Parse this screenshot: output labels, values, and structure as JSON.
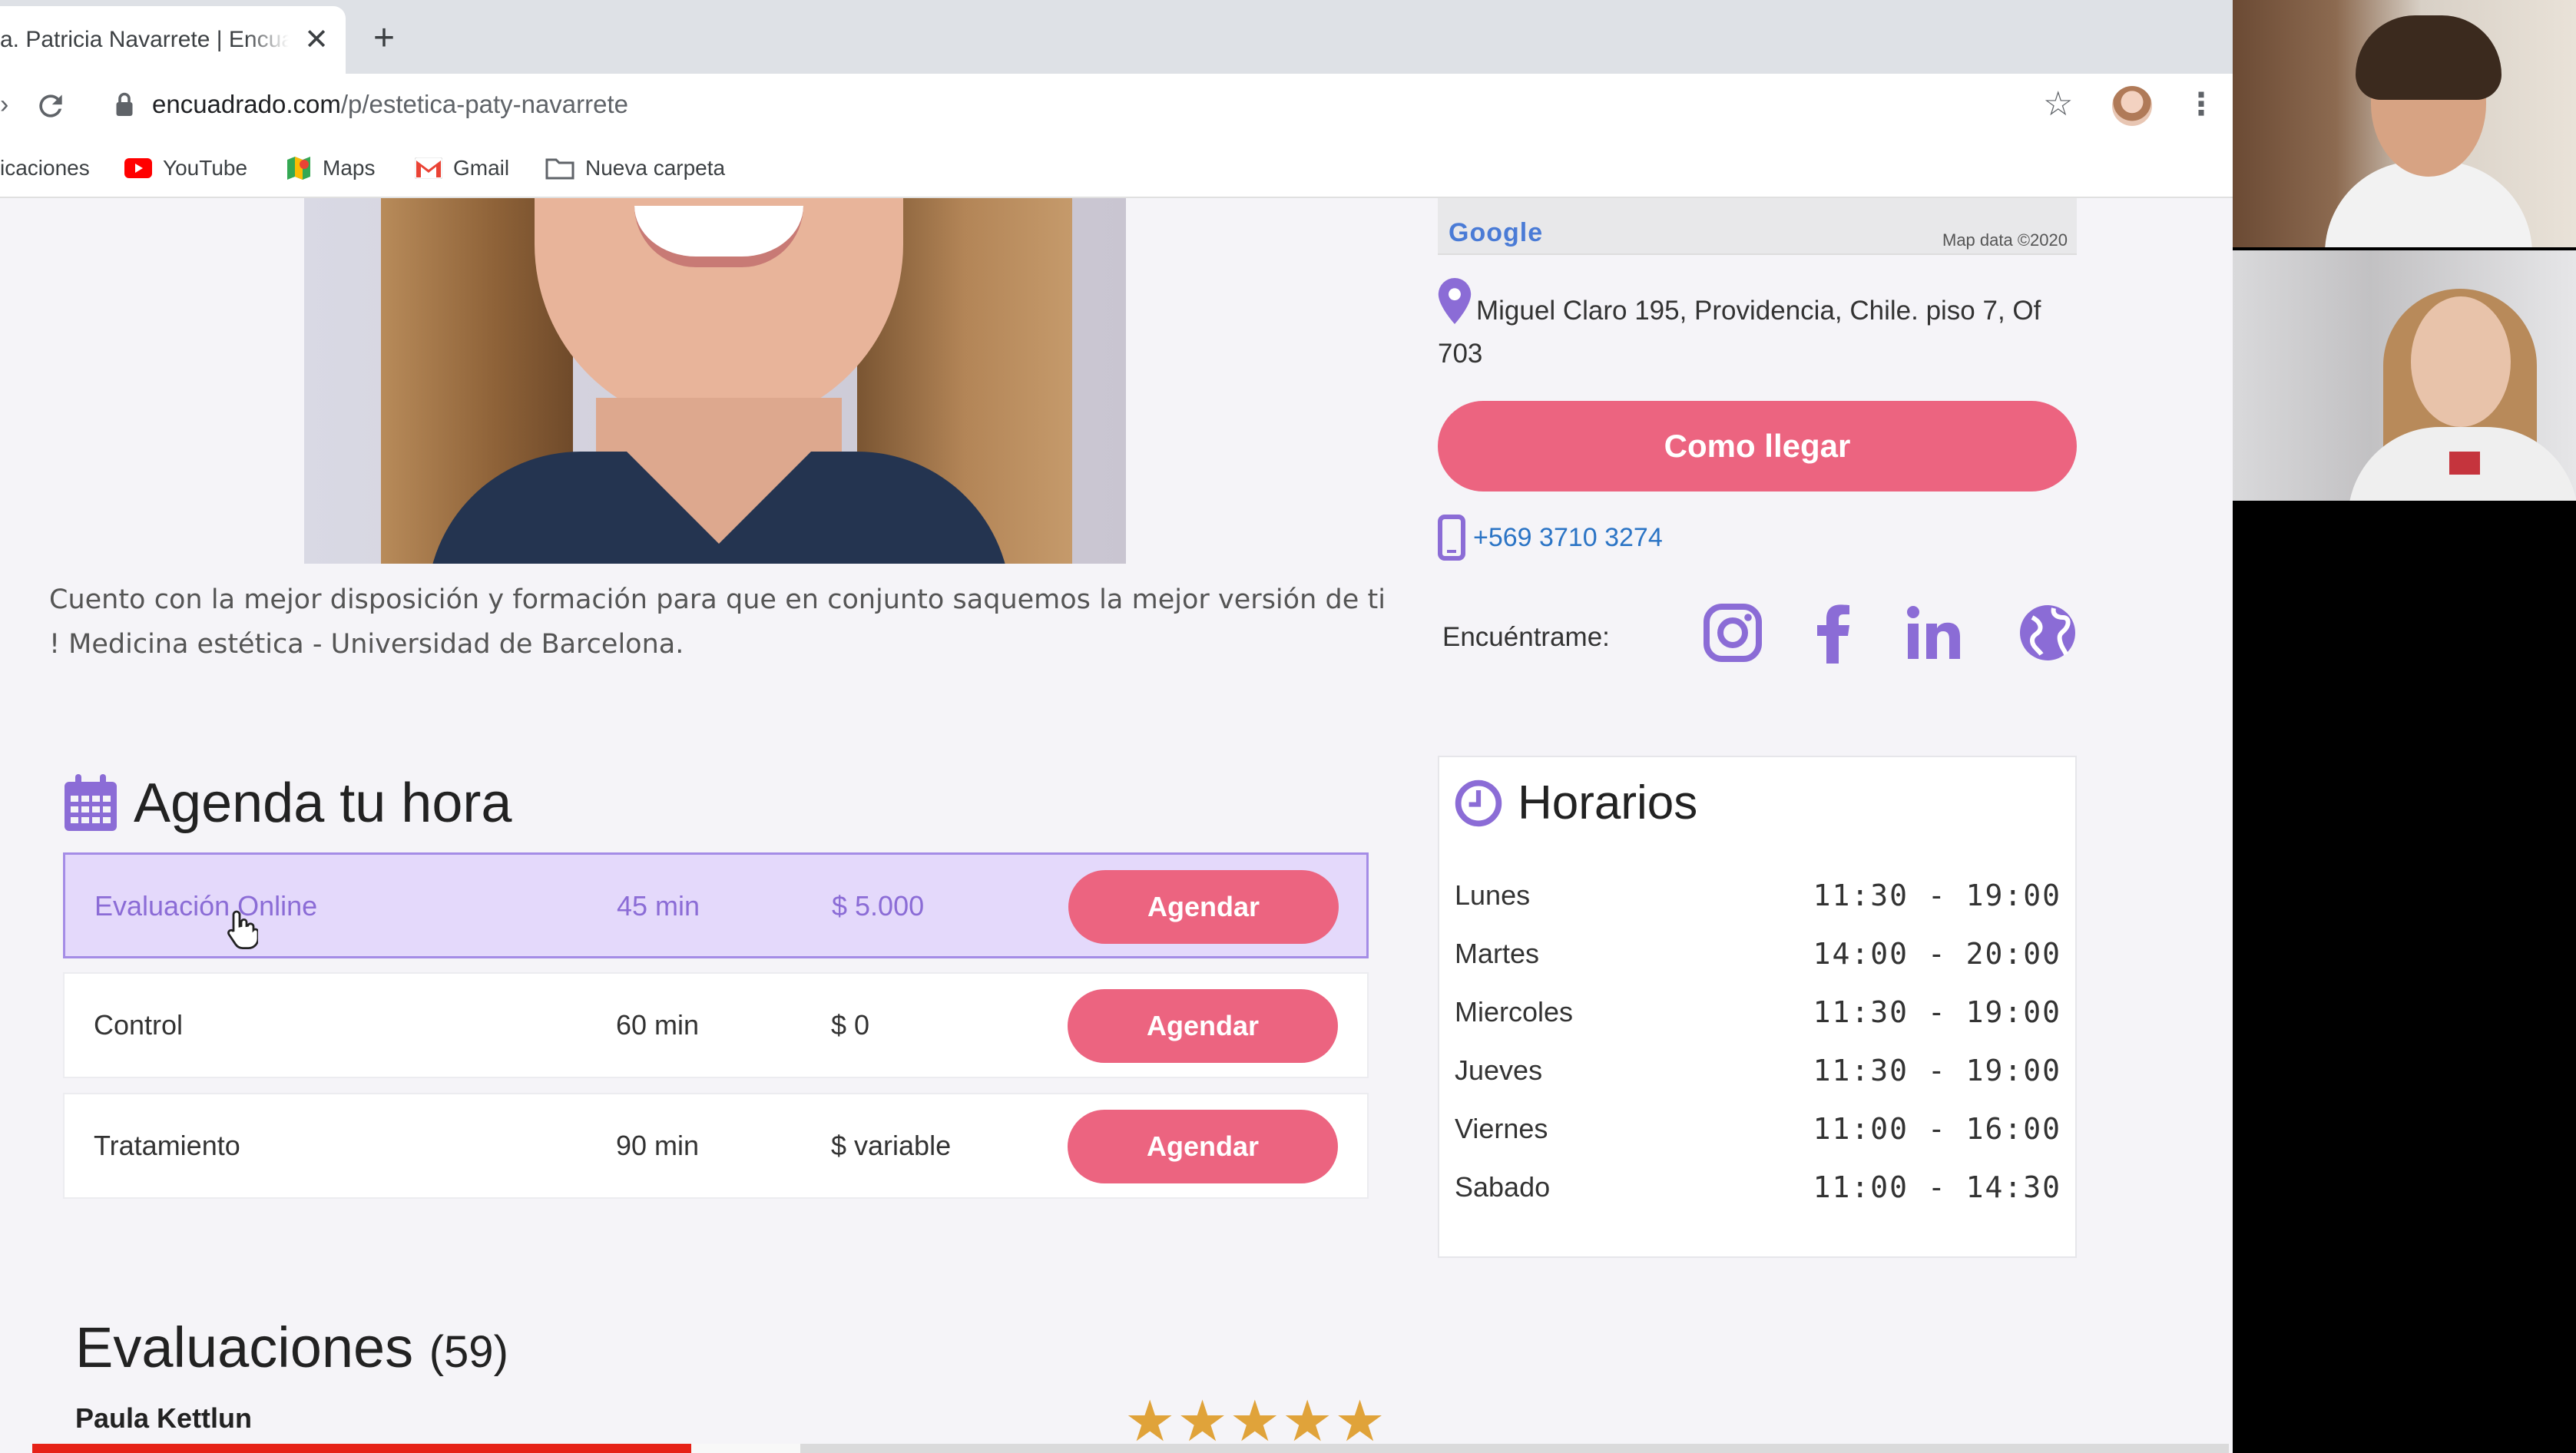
{
  "browser": {
    "tab_title": "a. Patricia Navarrete | Encua",
    "tab_close": "✕",
    "new_tab": "+",
    "url_domain": "encuadrado.com",
    "url_path": "/p/estetica-paty-navarrete",
    "bookmarks": [
      {
        "label": "icaciones",
        "icon": "apps-icon"
      },
      {
        "label": "YouTube",
        "icon": "youtube-icon"
      },
      {
        "label": "Maps",
        "icon": "maps-icon"
      },
      {
        "label": "Gmail",
        "icon": "gmail-icon"
      },
      {
        "label": "Nueva carpeta",
        "icon": "folder-icon"
      }
    ]
  },
  "profile": {
    "bio": "Cuento con la mejor disposición y formación para que en conjunto saquemos la mejor versión de ti ! Medicina estética - Universidad de Barcelona."
  },
  "contact": {
    "map_brand": "Google",
    "map_data": "Map data ©2020",
    "address": "Miguel Claro 195, Providencia, Chile. piso 7, Of 703",
    "directions_label": "Como llegar",
    "phone": "+569 3710 3274",
    "find_me_label": "Encuéntrame:",
    "social": [
      "instagram-icon",
      "facebook-icon",
      "linkedin-icon",
      "website-icon"
    ]
  },
  "agenda": {
    "title": "Agenda tu hora",
    "button_label": "Agendar",
    "services": [
      {
        "name": "Evaluación Online",
        "duration": "45 min",
        "price": "$ 5.000"
      },
      {
        "name": "Control",
        "duration": "60 min",
        "price": "$ 0"
      },
      {
        "name": "Tratamiento",
        "duration": "90 min",
        "price": "$ variable"
      }
    ]
  },
  "schedule": {
    "title": "Horarios",
    "rows": [
      {
        "day": "Lunes",
        "hours": "11:30 - 19:00"
      },
      {
        "day": "Martes",
        "hours": "14:00 - 20:00"
      },
      {
        "day": "Miercoles",
        "hours": "11:30 - 19:00"
      },
      {
        "day": "Jueves",
        "hours": "11:30 - 19:00"
      },
      {
        "day": "Viernes",
        "hours": "11:00 - 16:00"
      },
      {
        "day": "Sabado",
        "hours": "11:00 - 14:30"
      }
    ]
  },
  "reviews": {
    "title": "Evaluaciones",
    "count": "(59)",
    "first_reviewer": "Paula Kettlun",
    "stars": "★★★★★"
  },
  "colors": {
    "accent_pink": "#ec6480",
    "accent_purple": "#8b6cd6",
    "link_blue": "#2b74c5",
    "star_gold": "#e0a33a"
  },
  "video_progress": 0.3
}
